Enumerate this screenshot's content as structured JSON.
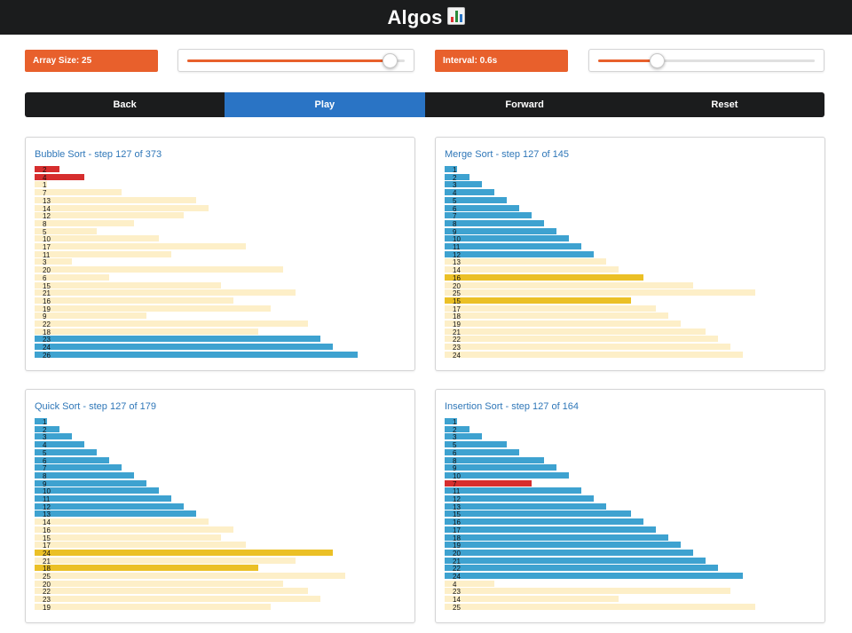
{
  "header": {
    "title": "Algos",
    "icon": "bar-chart-icon"
  },
  "controls": {
    "array_size_label": "Array Size: 25",
    "array_size_slider": 0.93,
    "interval_label": "Interval: 0.6s",
    "interval_slider": 0.27
  },
  "buttons": [
    {
      "label": "Back",
      "active": false
    },
    {
      "label": "Play",
      "active": true
    },
    {
      "label": "Forward",
      "active": false
    },
    {
      "label": "Reset",
      "active": false
    }
  ],
  "colors": {
    "default": "#fdefc8",
    "sorted": "#3ea2d0",
    "compare": "#d62e2e",
    "pivot": "#ebc026",
    "accent": "#e8602c",
    "active_button": "#2a74c5",
    "bar_text": "#111111",
    "title_text": "#2f77b8"
  },
  "max_value": 26,
  "panels": [
    {
      "id": "bubble",
      "title": "Bubble Sort - step 127 of 373",
      "bars": [
        {
          "v": 2,
          "s": "compare"
        },
        {
          "v": 4,
          "s": "compare"
        },
        {
          "v": 1,
          "s": "default"
        },
        {
          "v": 7,
          "s": "default"
        },
        {
          "v": 13,
          "s": "default"
        },
        {
          "v": 14,
          "s": "default"
        },
        {
          "v": 12,
          "s": "default"
        },
        {
          "v": 8,
          "s": "default"
        },
        {
          "v": 5,
          "s": "default"
        },
        {
          "v": 10,
          "s": "default"
        },
        {
          "v": 17,
          "s": "default"
        },
        {
          "v": 11,
          "s": "default"
        },
        {
          "v": 3,
          "s": "default"
        },
        {
          "v": 20,
          "s": "default"
        },
        {
          "v": 6,
          "s": "default"
        },
        {
          "v": 15,
          "s": "default"
        },
        {
          "v": 21,
          "s": "default"
        },
        {
          "v": 16,
          "s": "default"
        },
        {
          "v": 19,
          "s": "default"
        },
        {
          "v": 9,
          "s": "default"
        },
        {
          "v": 22,
          "s": "default"
        },
        {
          "v": 18,
          "s": "default"
        },
        {
          "v": 23,
          "s": "sorted"
        },
        {
          "v": 24,
          "s": "sorted"
        },
        {
          "v": 26,
          "s": "sorted"
        }
      ]
    },
    {
      "id": "merge",
      "title": "Merge Sort - step 127 of 145",
      "bars": [
        {
          "v": 1,
          "s": "sorted"
        },
        {
          "v": 2,
          "s": "sorted"
        },
        {
          "v": 3,
          "s": "sorted"
        },
        {
          "v": 4,
          "s": "sorted"
        },
        {
          "v": 5,
          "s": "sorted"
        },
        {
          "v": 6,
          "s": "sorted"
        },
        {
          "v": 7,
          "s": "sorted"
        },
        {
          "v": 8,
          "s": "sorted"
        },
        {
          "v": 9,
          "s": "sorted"
        },
        {
          "v": 10,
          "s": "sorted"
        },
        {
          "v": 11,
          "s": "sorted"
        },
        {
          "v": 12,
          "s": "sorted"
        },
        {
          "v": 13,
          "s": "default"
        },
        {
          "v": 14,
          "s": "default"
        },
        {
          "v": 16,
          "s": "pivot"
        },
        {
          "v": 20,
          "s": "default"
        },
        {
          "v": 25,
          "s": "default"
        },
        {
          "v": 15,
          "s": "pivot"
        },
        {
          "v": 17,
          "s": "default"
        },
        {
          "v": 18,
          "s": "default"
        },
        {
          "v": 19,
          "s": "default"
        },
        {
          "v": 21,
          "s": "default"
        },
        {
          "v": 22,
          "s": "default"
        },
        {
          "v": 23,
          "s": "default"
        },
        {
          "v": 24,
          "s": "default"
        }
      ]
    },
    {
      "id": "quick",
      "title": "Quick Sort - step 127 of 179",
      "bars": [
        {
          "v": 1,
          "s": "sorted"
        },
        {
          "v": 2,
          "s": "sorted"
        },
        {
          "v": 3,
          "s": "sorted"
        },
        {
          "v": 4,
          "s": "sorted"
        },
        {
          "v": 5,
          "s": "sorted"
        },
        {
          "v": 6,
          "s": "sorted"
        },
        {
          "v": 7,
          "s": "sorted"
        },
        {
          "v": 8,
          "s": "sorted"
        },
        {
          "v": 9,
          "s": "sorted"
        },
        {
          "v": 10,
          "s": "sorted"
        },
        {
          "v": 11,
          "s": "sorted"
        },
        {
          "v": 12,
          "s": "sorted"
        },
        {
          "v": 13,
          "s": "sorted"
        },
        {
          "v": 14,
          "s": "default"
        },
        {
          "v": 16,
          "s": "default"
        },
        {
          "v": 15,
          "s": "default"
        },
        {
          "v": 17,
          "s": "default"
        },
        {
          "v": 24,
          "s": "pivot"
        },
        {
          "v": 21,
          "s": "default"
        },
        {
          "v": 18,
          "s": "pivot"
        },
        {
          "v": 25,
          "s": "default"
        },
        {
          "v": 20,
          "s": "default"
        },
        {
          "v": 22,
          "s": "default"
        },
        {
          "v": 23,
          "s": "default"
        },
        {
          "v": 19,
          "s": "default"
        }
      ]
    },
    {
      "id": "insertion",
      "title": "Insertion Sort - step 127 of 164",
      "bars": [
        {
          "v": 1,
          "s": "sorted"
        },
        {
          "v": 2,
          "s": "sorted"
        },
        {
          "v": 3,
          "s": "sorted"
        },
        {
          "v": 5,
          "s": "sorted"
        },
        {
          "v": 6,
          "s": "sorted"
        },
        {
          "v": 8,
          "s": "sorted"
        },
        {
          "v": 9,
          "s": "sorted"
        },
        {
          "v": 10,
          "s": "sorted"
        },
        {
          "v": 7,
          "s": "compare"
        },
        {
          "v": 11,
          "s": "sorted"
        },
        {
          "v": 12,
          "s": "sorted"
        },
        {
          "v": 13,
          "s": "sorted"
        },
        {
          "v": 15,
          "s": "sorted"
        },
        {
          "v": 16,
          "s": "sorted"
        },
        {
          "v": 17,
          "s": "sorted"
        },
        {
          "v": 18,
          "s": "sorted"
        },
        {
          "v": 19,
          "s": "sorted"
        },
        {
          "v": 20,
          "s": "sorted"
        },
        {
          "v": 21,
          "s": "sorted"
        },
        {
          "v": 22,
          "s": "sorted"
        },
        {
          "v": 24,
          "s": "sorted"
        },
        {
          "v": 4,
          "s": "default"
        },
        {
          "v": 23,
          "s": "default"
        },
        {
          "v": 14,
          "s": "default"
        },
        {
          "v": 25,
          "s": "default"
        }
      ]
    }
  ]
}
